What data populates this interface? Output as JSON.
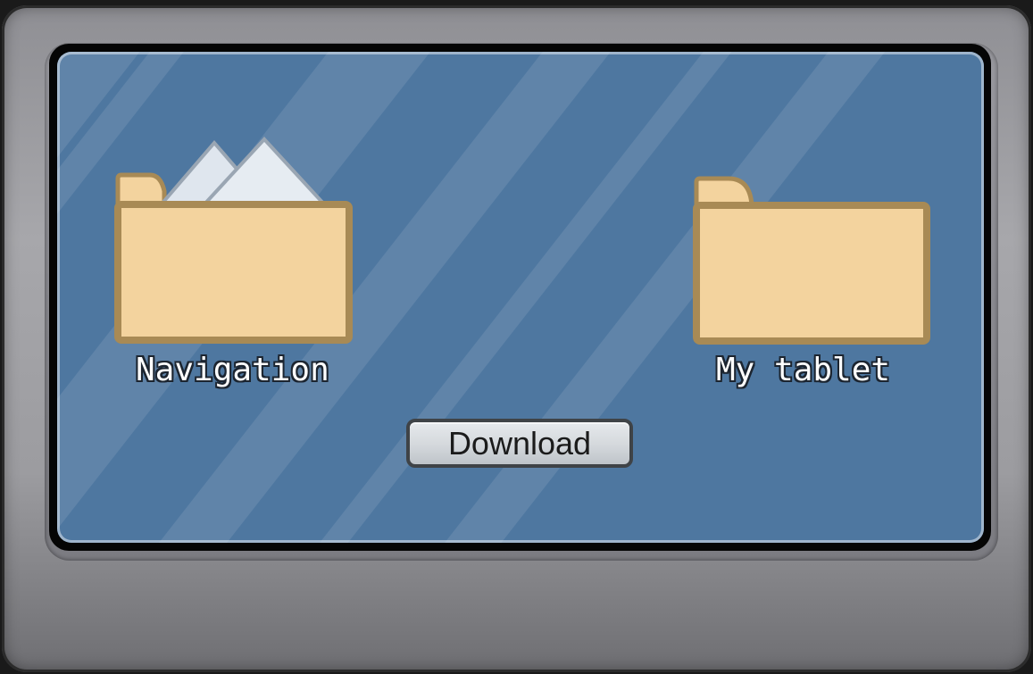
{
  "folders": [
    {
      "label": "Navigation",
      "icon": "folder-with-documents-icon"
    },
    {
      "label": "My tablet",
      "icon": "folder-icon"
    }
  ],
  "download_button": {
    "label": "Download"
  },
  "colors": {
    "screen": "#4e77a0",
    "folder_fill": "#f3d39e",
    "folder_outline": "#a88a55",
    "device_frame": "#a0a0a5"
  }
}
